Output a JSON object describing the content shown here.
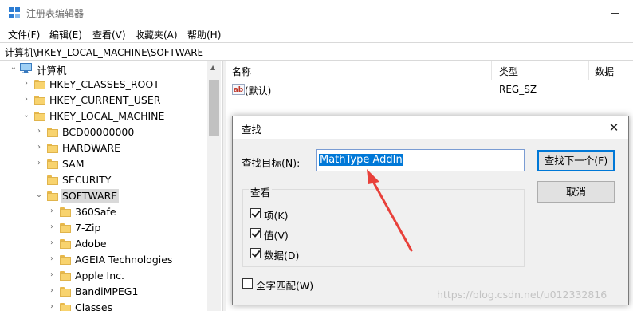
{
  "window": {
    "title": "注册表编辑器"
  },
  "menu": [
    "文件(F)",
    "编辑(E)",
    "查看(V)",
    "收藏夹(A)",
    "帮助(H)"
  ],
  "address": "计算机\\HKEY_LOCAL_MACHINE\\SOFTWARE",
  "tree": {
    "root": "计算机",
    "items": [
      "HKEY_CLASSES_ROOT",
      "HKEY_CURRENT_USER",
      "HKEY_LOCAL_MACHINE",
      "BCD00000000",
      "HARDWARE",
      "SAM",
      "SECURITY",
      "SOFTWARE",
      "360Safe",
      "7-Zip",
      "Adobe",
      "AGEIA Technologies",
      "Apple Inc.",
      "BandiMPEG1",
      "Classes"
    ]
  },
  "list": {
    "columns": [
      "名称",
      "类型",
      "数据"
    ],
    "rows": [
      {
        "icon": "ab",
        "name": "(默认)",
        "type": "REG_SZ"
      }
    ]
  },
  "dialog": {
    "title": "查找",
    "find_label": "查找目标(N):",
    "find_value": "MathType AddIn",
    "find_next": "查找下一个(F)",
    "cancel": "取消",
    "group_title": "查看",
    "options": [
      "项(K)",
      "值(V)",
      "数据(D)"
    ],
    "whole_string": "全字匹配(W)"
  },
  "watermark": "https://blog.csdn.net/u012332816",
  "colors": {
    "selection": "#0078d7",
    "annotation_arrow": "#e8403a",
    "folder": "#f8d36e"
  }
}
